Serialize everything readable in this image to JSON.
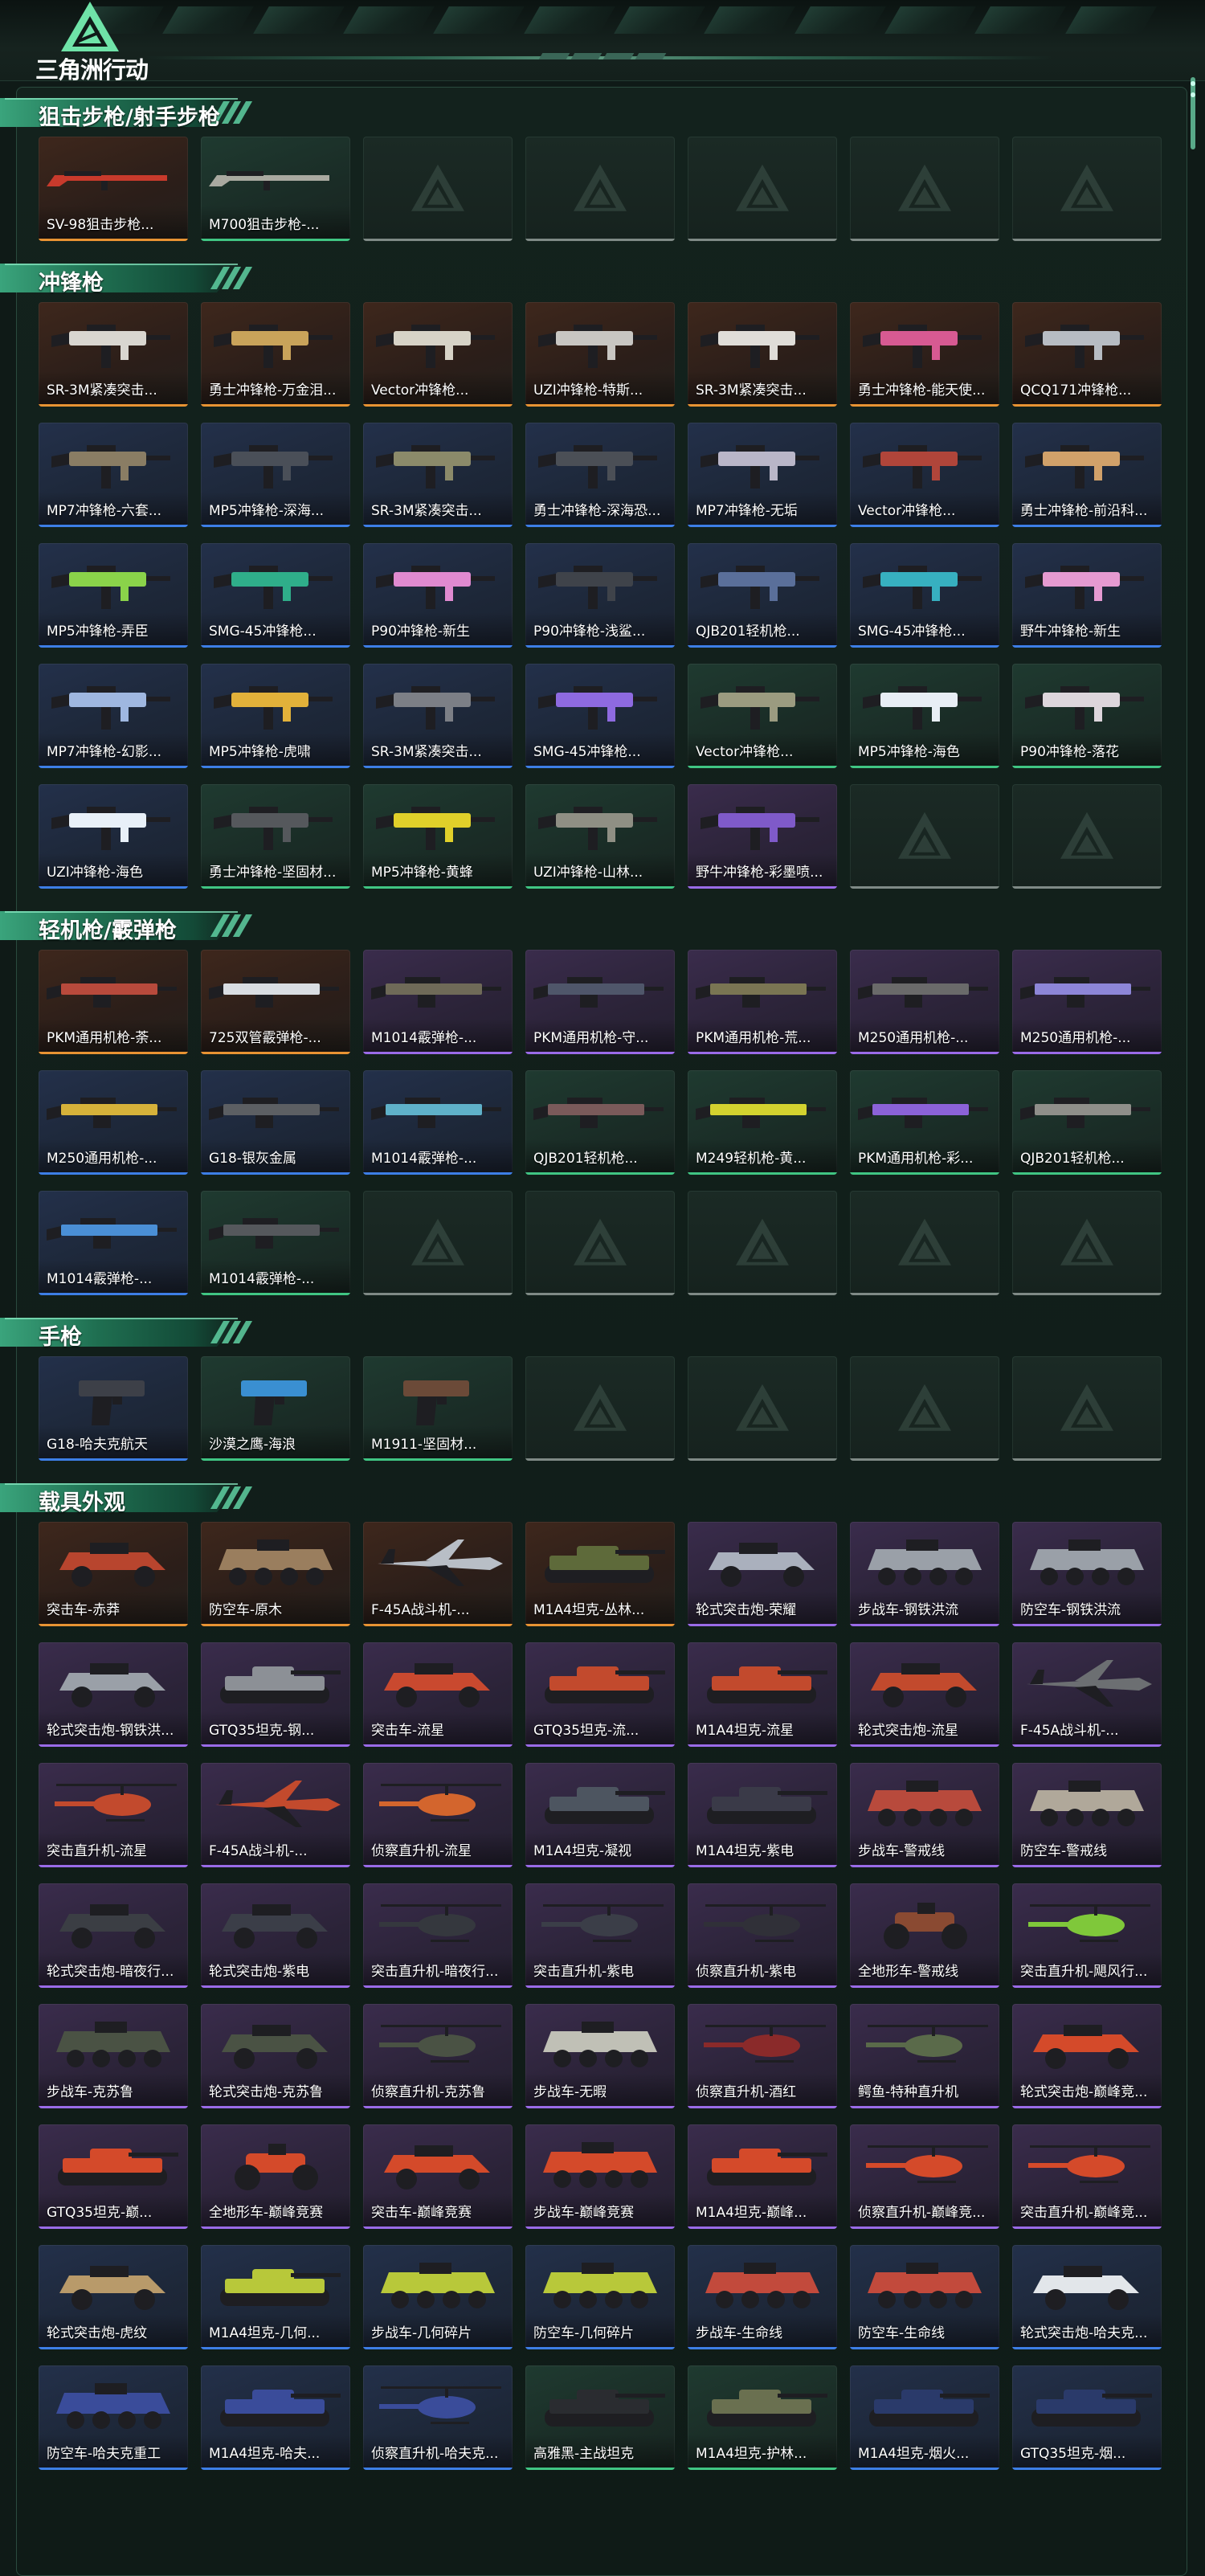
{
  "app": {
    "logo_text": "三角洲行动"
  },
  "sections": [
    {
      "title": "狙击步枪/射手步枪",
      "items": [
        {
          "label": "SV-98狙击步枪...",
          "rarity": "orange",
          "kind": "rifle",
          "color": "#c83a2c"
        },
        {
          "label": "M700狙击步枪-...",
          "rarity": "green",
          "kind": "rifle",
          "color": "#a9a9a0"
        },
        {
          "empty": true
        },
        {
          "empty": true
        },
        {
          "empty": true
        },
        {
          "empty": true
        },
        {
          "empty": true
        }
      ]
    },
    {
      "title": "冲锋枪",
      "items": [
        {
          "label": "SR-3M紧凑突击...",
          "rarity": "orange",
          "kind": "smg",
          "color": "#d9d6d0"
        },
        {
          "label": "勇士冲锋枪-万金泪...",
          "rarity": "orange",
          "kind": "smg",
          "color": "#c9a35a"
        },
        {
          "label": "Vector冲锋枪...",
          "rarity": "orange",
          "kind": "smg",
          "color": "#d7d3c7"
        },
        {
          "label": "UZI冲锋枪-特斯...",
          "rarity": "orange",
          "kind": "smg",
          "color": "#c8c6c2"
        },
        {
          "label": "SR-3M紧凑突击...",
          "rarity": "orange",
          "kind": "smg",
          "color": "#e0ddd8"
        },
        {
          "label": "勇士冲锋枪-能天使...",
          "rarity": "orange",
          "kind": "smg",
          "color": "#d75a92"
        },
        {
          "label": "QCQ171冲锋枪...",
          "rarity": "orange",
          "kind": "smg",
          "color": "#b7bcc3"
        },
        {
          "label": "MP7冲锋枪-六套...",
          "rarity": "blue",
          "kind": "smg",
          "color": "#8a7d64"
        },
        {
          "label": "MP5冲锋枪-深海...",
          "rarity": "blue",
          "kind": "smg",
          "color": "#4a4f58"
        },
        {
          "label": "SR-3M紧凑突击...",
          "rarity": "blue",
          "kind": "smg",
          "color": "#8b8a6a"
        },
        {
          "label": "勇士冲锋枪-深海恐...",
          "rarity": "blue",
          "kind": "smg",
          "color": "#4b4f56"
        },
        {
          "label": "MP7冲锋枪-无垢",
          "rarity": "blue",
          "kind": "smg",
          "color": "#b9b6c8"
        },
        {
          "label": "Vector冲锋枪...",
          "rarity": "blue",
          "kind": "smg",
          "color": "#b0453a"
        },
        {
          "label": "勇士冲锋枪-前沿科...",
          "rarity": "blue",
          "kind": "smg",
          "color": "#d1a16a"
        },
        {
          "label": "MP5冲锋枪-弄臣",
          "rarity": "blue",
          "kind": "smg",
          "color": "#8ad34a"
        },
        {
          "label": "SMG-45冲锋枪...",
          "rarity": "blue",
          "kind": "smg",
          "color": "#2fae8a"
        },
        {
          "label": "P90冲锋枪-新生",
          "rarity": "blue",
          "kind": "smg",
          "color": "#e08ad0"
        },
        {
          "label": "P90冲锋枪-浅鲨...",
          "rarity": "blue",
          "kind": "smg",
          "color": "#3f434a"
        },
        {
          "label": "QJB201轻机枪...",
          "rarity": "blue",
          "kind": "smg",
          "color": "#5a6f9a"
        },
        {
          "label": "SMG-45冲锋枪...",
          "rarity": "blue",
          "kind": "smg",
          "color": "#37b0c0"
        },
        {
          "label": "野牛冲锋枪-新生",
          "rarity": "blue",
          "kind": "smg",
          "color": "#e59ad1"
        },
        {
          "label": "MP7冲锋枪-幻影...",
          "rarity": "blue",
          "kind": "smg",
          "color": "#9fb7e0"
        },
        {
          "label": "MP5冲锋枪-虎啸",
          "rarity": "blue",
          "kind": "smg",
          "color": "#e2b13a"
        },
        {
          "label": "SR-3M紧凑突击...",
          "rarity": "blue",
          "kind": "smg",
          "color": "#7c7f86"
        },
        {
          "label": "SMG-45冲锋枪...",
          "rarity": "blue",
          "kind": "smg",
          "color": "#8e6ae0"
        },
        {
          "label": "Vector冲锋枪...",
          "rarity": "green",
          "kind": "smg",
          "color": "#9b9b80"
        },
        {
          "label": "MP5冲锋枪-海色",
          "rarity": "green",
          "kind": "smg",
          "color": "#e8eef5"
        },
        {
          "label": "P90冲锋枪-落花",
          "rarity": "green",
          "kind": "smg",
          "color": "#ddd6dc"
        },
        {
          "label": "UZI冲锋枪-海色",
          "rarity": "blue",
          "kind": "smg",
          "color": "#e8f0f8"
        },
        {
          "label": "勇士冲锋枪-坚固材...",
          "rarity": "green",
          "kind": "smg",
          "color": "#55585c"
        },
        {
          "label": "MP5冲锋枪-黄蜂",
          "rarity": "green",
          "kind": "smg",
          "color": "#e0d02a"
        },
        {
          "label": "UZI冲锋枪-山林...",
          "rarity": "green",
          "kind": "smg",
          "color": "#8f8f84"
        },
        {
          "label": "野牛冲锋枪-彩墨喷...",
          "rarity": "purple",
          "kind": "smg",
          "color": "#7f5ac9"
        },
        {
          "empty": true
        },
        {
          "empty": true
        }
      ]
    },
    {
      "title": "轻机枪/霰弹枪",
      "items": [
        {
          "label": "PKM通用机枪-荼...",
          "rarity": "orange",
          "kind": "lmg",
          "color": "#b84a3c"
        },
        {
          "label": "725双管霰弹枪-...",
          "rarity": "orange",
          "kind": "lmg",
          "color": "#d9dde2"
        },
        {
          "label": "M1014霰弹枪-...",
          "rarity": "purple",
          "kind": "lmg",
          "color": "#6f6a58"
        },
        {
          "label": "PKM通用机枪-守...",
          "rarity": "purple",
          "kind": "lmg",
          "color": "#4f566a"
        },
        {
          "label": "PKM通用机枪-荒...",
          "rarity": "purple",
          "kind": "lmg",
          "color": "#7a7553"
        },
        {
          "label": "M250通用机枪-...",
          "rarity": "purple",
          "kind": "lmg",
          "color": "#6a6a6a"
        },
        {
          "label": "M250通用机枪-...",
          "rarity": "purple",
          "kind": "lmg",
          "color": "#8d86d8"
        },
        {
          "label": "M250通用机枪-...",
          "rarity": "blue",
          "kind": "lmg",
          "color": "#d6b23a"
        },
        {
          "label": "G18-银灰金属",
          "rarity": "blue",
          "kind": "lmg",
          "color": "#5c5f63"
        },
        {
          "label": "M1014霰弹枪-...",
          "rarity": "blue",
          "kind": "lmg",
          "color": "#5fb1c9"
        },
        {
          "label": "QJB201轻机枪...",
          "rarity": "green",
          "kind": "lmg",
          "color": "#7a5a5a"
        },
        {
          "label": "M249轻机枪-黄...",
          "rarity": "green",
          "kind": "lmg",
          "color": "#d3d22f"
        },
        {
          "label": "PKM通用机枪-彩...",
          "rarity": "green",
          "kind": "lmg",
          "color": "#8b62d8"
        },
        {
          "label": "QJB201轻机枪...",
          "rarity": "green",
          "kind": "lmg",
          "color": "#8f8f8a"
        },
        {
          "label": "M1014霰弹枪-...",
          "rarity": "blue",
          "kind": "lmg",
          "color": "#4a8fd6"
        },
        {
          "label": "M1014霰弹枪-...",
          "rarity": "green",
          "kind": "lmg",
          "color": "#55585c"
        },
        {
          "empty": true
        },
        {
          "empty": true
        },
        {
          "empty": true
        },
        {
          "empty": true
        },
        {
          "empty": true
        }
      ]
    },
    {
      "title": "手枪",
      "items": [
        {
          "label": "G18-哈夫克航天",
          "rarity": "blue",
          "kind": "pistol",
          "color": "#3d4048"
        },
        {
          "label": "沙漠之鹰-海浪",
          "rarity": "green",
          "kind": "pistol",
          "color": "#3a8fd1"
        },
        {
          "label": "M1911-坚固材...",
          "rarity": "green",
          "kind": "pistol",
          "color": "#6b4a38"
        },
        {
          "empty": true
        },
        {
          "empty": true
        },
        {
          "empty": true
        },
        {
          "empty": true
        }
      ]
    },
    {
      "title": "载具外观",
      "items": [
        {
          "label": "突击车-赤莽",
          "rarity": "orange",
          "kind": "car",
          "color": "#b8452e"
        },
        {
          "label": "防空车-原木",
          "rarity": "orange",
          "kind": "apc",
          "color": "#9a7e5e"
        },
        {
          "label": "F-45A战斗机-...",
          "rarity": "orange",
          "kind": "jet",
          "color": "#b8bec6"
        },
        {
          "label": "M1A4坦克-丛林...",
          "rarity": "orange",
          "kind": "tank",
          "color": "#5e6a3a"
        },
        {
          "label": "轮式突击炮-荣耀",
          "rarity": "purple",
          "kind": "car",
          "color": "#aab0bd"
        },
        {
          "label": "步战车-钢铁洪流",
          "rarity": "purple",
          "kind": "apc",
          "color": "#9aa0a8"
        },
        {
          "label": "防空车-钢铁洪流",
          "rarity": "purple",
          "kind": "apc",
          "color": "#9aa0a8"
        },
        {
          "label": "轮式突击炮-钢铁洪...",
          "rarity": "purple",
          "kind": "car",
          "color": "#9aa0a8"
        },
        {
          "label": "GTQ35坦克-钢...",
          "rarity": "purple",
          "kind": "tank",
          "color": "#8c9096"
        },
        {
          "label": "突击车-流星",
          "rarity": "purple",
          "kind": "car",
          "color": "#c9492f"
        },
        {
          "label": "GTQ35坦克-流...",
          "rarity": "purple",
          "kind": "tank",
          "color": "#c24a2d"
        },
        {
          "label": "M1A4坦克-流星",
          "rarity": "purple",
          "kind": "tank",
          "color": "#c24a2d"
        },
        {
          "label": "轮式突击炮-流星",
          "rarity": "purple",
          "kind": "car",
          "color": "#c24a2d"
        },
        {
          "label": "F-45A战斗机-...",
          "rarity": "purple",
          "kind": "jet",
          "color": "#6c6f72"
        },
        {
          "label": "突击直升机-流星",
          "rarity": "purple",
          "kind": "heli",
          "color": "#c24a2d"
        },
        {
          "label": "F-45A战斗机-...",
          "rarity": "purple",
          "kind": "jet",
          "color": "#c24a2d"
        },
        {
          "label": "侦察直升机-流星",
          "rarity": "purple",
          "kind": "heli",
          "color": "#d3652d"
        },
        {
          "label": "M1A4坦克-凝视",
          "rarity": "purple",
          "kind": "tank",
          "color": "#4d5560"
        },
        {
          "label": "M1A4坦克-紫电",
          "rarity": "purple",
          "kind": "tank",
          "color": "#3a3a48"
        },
        {
          "label": "步战车-警戒线",
          "rarity": "purple",
          "kind": "apc",
          "color": "#b84a3c"
        },
        {
          "label": "防空车-警戒线",
          "rarity": "purple",
          "kind": "apc",
          "color": "#b0a89a"
        },
        {
          "label": "轮式突击炮-暗夜行...",
          "rarity": "purple",
          "kind": "car",
          "color": "#3b3e44"
        },
        {
          "label": "轮式突击炮-紫电",
          "rarity": "purple",
          "kind": "car",
          "color": "#3b3e48"
        },
        {
          "label": "突击直升机-暗夜行...",
          "rarity": "purple",
          "kind": "heli",
          "color": "#35383e"
        },
        {
          "label": "突击直升机-紫电",
          "rarity": "purple",
          "kind": "heli",
          "color": "#3b3e48"
        },
        {
          "label": "侦察直升机-紫电",
          "rarity": "purple",
          "kind": "heli",
          "color": "#303038"
        },
        {
          "label": "全地形车-警戒线",
          "rarity": "purple",
          "kind": "atv",
          "color": "#8a4a32"
        },
        {
          "label": "突击直升机-飓风行...",
          "rarity": "purple",
          "kind": "heli",
          "color": "#7fc83a"
        },
        {
          "label": "步战车-克苏鲁",
          "rarity": "purple",
          "kind": "apc",
          "color": "#4a5244"
        },
        {
          "label": "轮式突击炮-克苏鲁",
          "rarity": "purple",
          "kind": "car",
          "color": "#4a5244"
        },
        {
          "label": "侦察直升机-克苏鲁",
          "rarity": "purple",
          "kind": "heli",
          "color": "#4a5244"
        },
        {
          "label": "步战车-无暇",
          "rarity": "purple",
          "kind": "apc",
          "color": "#c0c0b6"
        },
        {
          "label": "侦察直升机-酒红",
          "rarity": "purple",
          "kind": "heli",
          "color": "#8a2a2a"
        },
        {
          "label": "鳄鱼-特种直升机",
          "rarity": "purple",
          "kind": "heli",
          "color": "#5a6a4a"
        },
        {
          "label": "轮式突击炮-巅峰竞...",
          "rarity": "purple",
          "kind": "car",
          "color": "#d44a2a"
        },
        {
          "label": "GTQ35坦克-巅...",
          "rarity": "purple",
          "kind": "tank",
          "color": "#d44a2a"
        },
        {
          "label": "全地形车-巅峰竞赛",
          "rarity": "purple",
          "kind": "atv",
          "color": "#d44a2a"
        },
        {
          "label": "突击车-巅峰竞赛",
          "rarity": "purple",
          "kind": "car",
          "color": "#d44a2a"
        },
        {
          "label": "步战车-巅峰竞赛",
          "rarity": "purple",
          "kind": "apc",
          "color": "#d44a2a"
        },
        {
          "label": "M1A4坦克-巅峰...",
          "rarity": "purple",
          "kind": "tank",
          "color": "#d44a2a"
        },
        {
          "label": "侦察直升机-巅峰竞...",
          "rarity": "purple",
          "kind": "heli",
          "color": "#d44a2a"
        },
        {
          "label": "突击直升机-巅峰竞...",
          "rarity": "purple",
          "kind": "heli",
          "color": "#d44a2a"
        },
        {
          "label": "轮式突击炮-虎纹",
          "rarity": "blue",
          "kind": "car",
          "color": "#b89a6a"
        },
        {
          "label": "M1A4坦克-几何...",
          "rarity": "blue",
          "kind": "tank",
          "color": "#b8c83a"
        },
        {
          "label": "步战车-几何碎片",
          "rarity": "blue",
          "kind": "apc",
          "color": "#b8c83a"
        },
        {
          "label": "防空车-几何碎片",
          "rarity": "blue",
          "kind": "apc",
          "color": "#b8c83a"
        },
        {
          "label": "步战车-生命线",
          "rarity": "blue",
          "kind": "apc",
          "color": "#c24a3c"
        },
        {
          "label": "防空车-生命线",
          "rarity": "blue",
          "kind": "apc",
          "color": "#c24a3c"
        },
        {
          "label": "轮式突击炮-哈夫克...",
          "rarity": "blue",
          "kind": "car",
          "color": "#e2e6ea"
        },
        {
          "label": "防空车-哈夫克重工",
          "rarity": "blue",
          "kind": "apc",
          "color": "#3a4c9a"
        },
        {
          "label": "M1A4坦克-哈夫...",
          "rarity": "blue",
          "kind": "tank",
          "color": "#3a4c9a"
        },
        {
          "label": "侦察直升机-哈夫克...",
          "rarity": "blue",
          "kind": "heli",
          "color": "#3a4c9a"
        },
        {
          "label": "高雅黑-主战坦克",
          "rarity": "green",
          "kind": "tank",
          "color": "#2a2c30"
        },
        {
          "label": "M1A4坦克-护林...",
          "rarity": "green",
          "kind": "tank",
          "color": "#6a7050"
        },
        {
          "label": "M1A4坦克-烟火...",
          "rarity": "blue",
          "kind": "tank",
          "color": "#2a3a6a"
        },
        {
          "label": "GTQ35坦克-烟...",
          "rarity": "blue",
          "kind": "tank",
          "color": "#2a3a6a"
        }
      ]
    }
  ]
}
